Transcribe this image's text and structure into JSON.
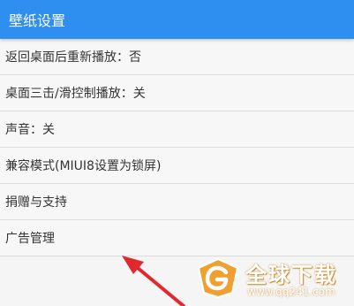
{
  "header": {
    "title": "壁纸设置"
  },
  "settings": {
    "items": [
      {
        "label": "返回桌面后重新播放：否"
      },
      {
        "label": "桌面三击/滑控制播放：关"
      },
      {
        "label": "声音：关"
      },
      {
        "label": "兼容模式(MIUI8设置为锁屏)"
      },
      {
        "label": "捐赠与支持"
      },
      {
        "label": "广告管理"
      }
    ]
  },
  "annotation": {
    "arrow_color": "#e0282e"
  },
  "watermark": {
    "title": "全球下载",
    "url": "www.qq241.com",
    "color": "#f0a030"
  },
  "colors": {
    "app_bar": "#2f8ff0",
    "list_background": "#f7f7f7",
    "divider": "#dcdcdc"
  }
}
